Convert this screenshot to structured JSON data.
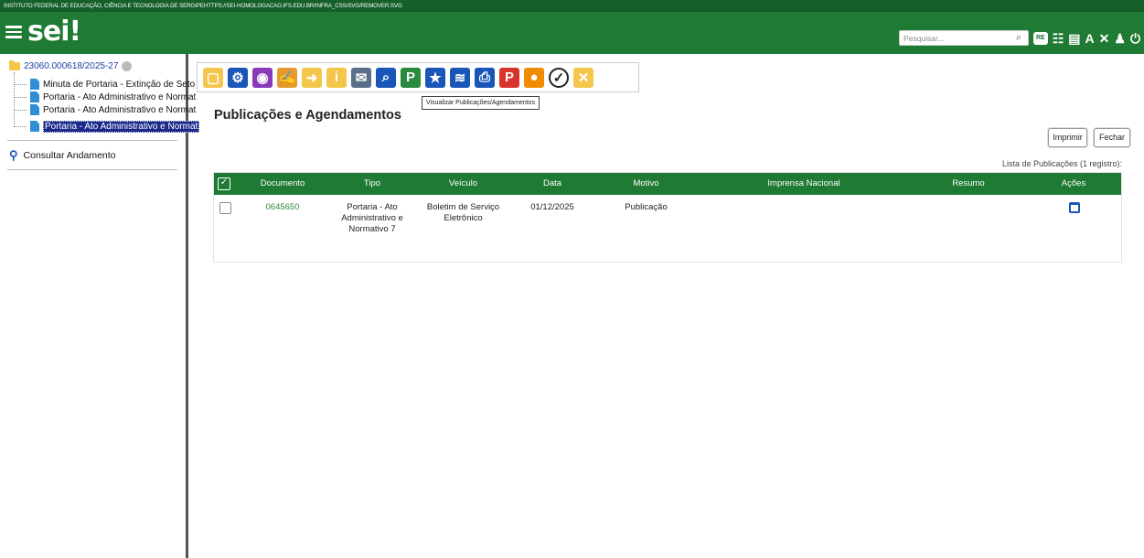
{
  "header": {
    "institution": "INSTITUTO FEDERAL DE EDUCAÇÃO, CIÊNCIA E TECNOLOGIA DE SERGIPEHTTPS://SEI-HOMOLOGACAO.IFS.EDU.BR/INFRA_CSS/SVG/REMOVER.SVG",
    "logo": "sei",
    "logo_mark": "!",
    "search_placeholder": "Pesquisar...",
    "re_badge": "RE",
    "icons": [
      "grid-icon",
      "calendar-icon",
      "font-size-icon",
      "tools-icon",
      "user-icon",
      "power-icon"
    ],
    "icon_glyphs": [
      "☷",
      "▤",
      "A",
      "✕",
      "♟",
      "⏻"
    ]
  },
  "sidebar": {
    "process_number": "23060.000618/2025-27",
    "tree": [
      {
        "label": "Minuta de Portaria - Extinção de Seto",
        "selected": false
      },
      {
        "label": "Portaria - Ato Administrativo e Normat",
        "selected": false
      },
      {
        "label": "Portaria - Ato Administrativo e Normat",
        "selected": false
      },
      {
        "label": "Portaria - Ato Administrativo e Normat",
        "selected": true
      }
    ],
    "consultar_label": "Consultar Andamento"
  },
  "toolbar": {
    "tooltip": "Visualizar Publicações/Agendamentos",
    "icons": [
      {
        "name": "new-document-icon",
        "color": "#f4c64b",
        "glyph": "▢"
      },
      {
        "name": "document-settings-icon",
        "color": "#1a56b8",
        "glyph": "⚙"
      },
      {
        "name": "view-icon",
        "color": "#8a3ab9",
        "glyph": "◉"
      },
      {
        "name": "sign-icon",
        "color": "#e69a2e",
        "glyph": "✍"
      },
      {
        "name": "send-icon",
        "color": "#f4c64b",
        "glyph": "➜"
      },
      {
        "name": "info-icon",
        "color": "#f4c64b",
        "glyph": "i"
      },
      {
        "name": "email-icon",
        "color": "#5a6e8a",
        "glyph": "✉"
      },
      {
        "name": "search-document-icon",
        "color": "#1a56b8",
        "glyph": "⌕"
      },
      {
        "name": "publish-icon",
        "color": "#2a8a3e",
        "glyph": "P"
      },
      {
        "name": "favorite-icon",
        "color": "#1a56b8",
        "glyph": "★"
      },
      {
        "name": "layers-icon",
        "color": "#1a56b8",
        "glyph": "≋"
      },
      {
        "name": "print-icon",
        "color": "#1a56b8",
        "glyph": "⎙"
      },
      {
        "name": "pdf-icon",
        "color": "#d9342b",
        "glyph": "P"
      },
      {
        "name": "comment-icon",
        "color": "#f08c00",
        "glyph": "●"
      },
      {
        "name": "check-icon",
        "color": "#222",
        "glyph": "✓"
      },
      {
        "name": "cancel-document-icon",
        "color": "#f4c64b",
        "glyph": "✕"
      }
    ]
  },
  "main": {
    "title": "Publicações e Agendamentos",
    "print_button": "Imprimir",
    "close_button": "Fechar",
    "list_caption": "Lista de Publicações (1 registro):",
    "columns": [
      "Documento",
      "Tipo",
      "Veículo",
      "Data",
      "Motivo",
      "Imprensa Nacional",
      "Resumo",
      "Ações"
    ],
    "rows": [
      {
        "documento": "0645650",
        "tipo": "Portaria - Ato Administrativo e Normativo 7",
        "veiculo": "Boletim de Serviço Eletrônico",
        "data": "01/12/2025",
        "motivo": "Publicação",
        "imprensa": "",
        "resumo": ""
      }
    ]
  }
}
